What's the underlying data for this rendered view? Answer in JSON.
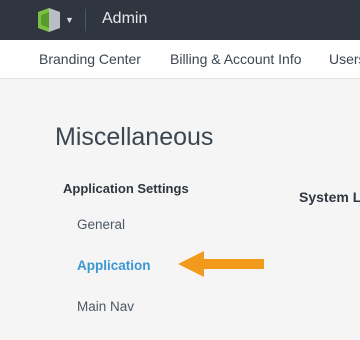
{
  "header": {
    "title": "Admin",
    "logo_icon": "app-logo-icon",
    "dropdown_icon": "chevron-down-icon"
  },
  "nav": {
    "items": [
      {
        "label": "Branding Center"
      },
      {
        "label": "Billing & Account Info"
      },
      {
        "label": "Users"
      }
    ]
  },
  "page": {
    "title": "Miscellaneous"
  },
  "sidebar": {
    "section_title": "Application Settings",
    "items": [
      {
        "label": "General",
        "active": false
      },
      {
        "label": "Application",
        "active": true
      },
      {
        "label": "Main Nav",
        "active": false
      }
    ]
  },
  "main": {
    "heading": "System L"
  },
  "annotation": {
    "icon": "arrow-left-icon",
    "color": "#f29a1b"
  },
  "colors": {
    "topbar_bg": "#2f3640",
    "active_link": "#3b97d3",
    "logo_green": "#7ac143",
    "logo_gray": "#b9bec4"
  }
}
